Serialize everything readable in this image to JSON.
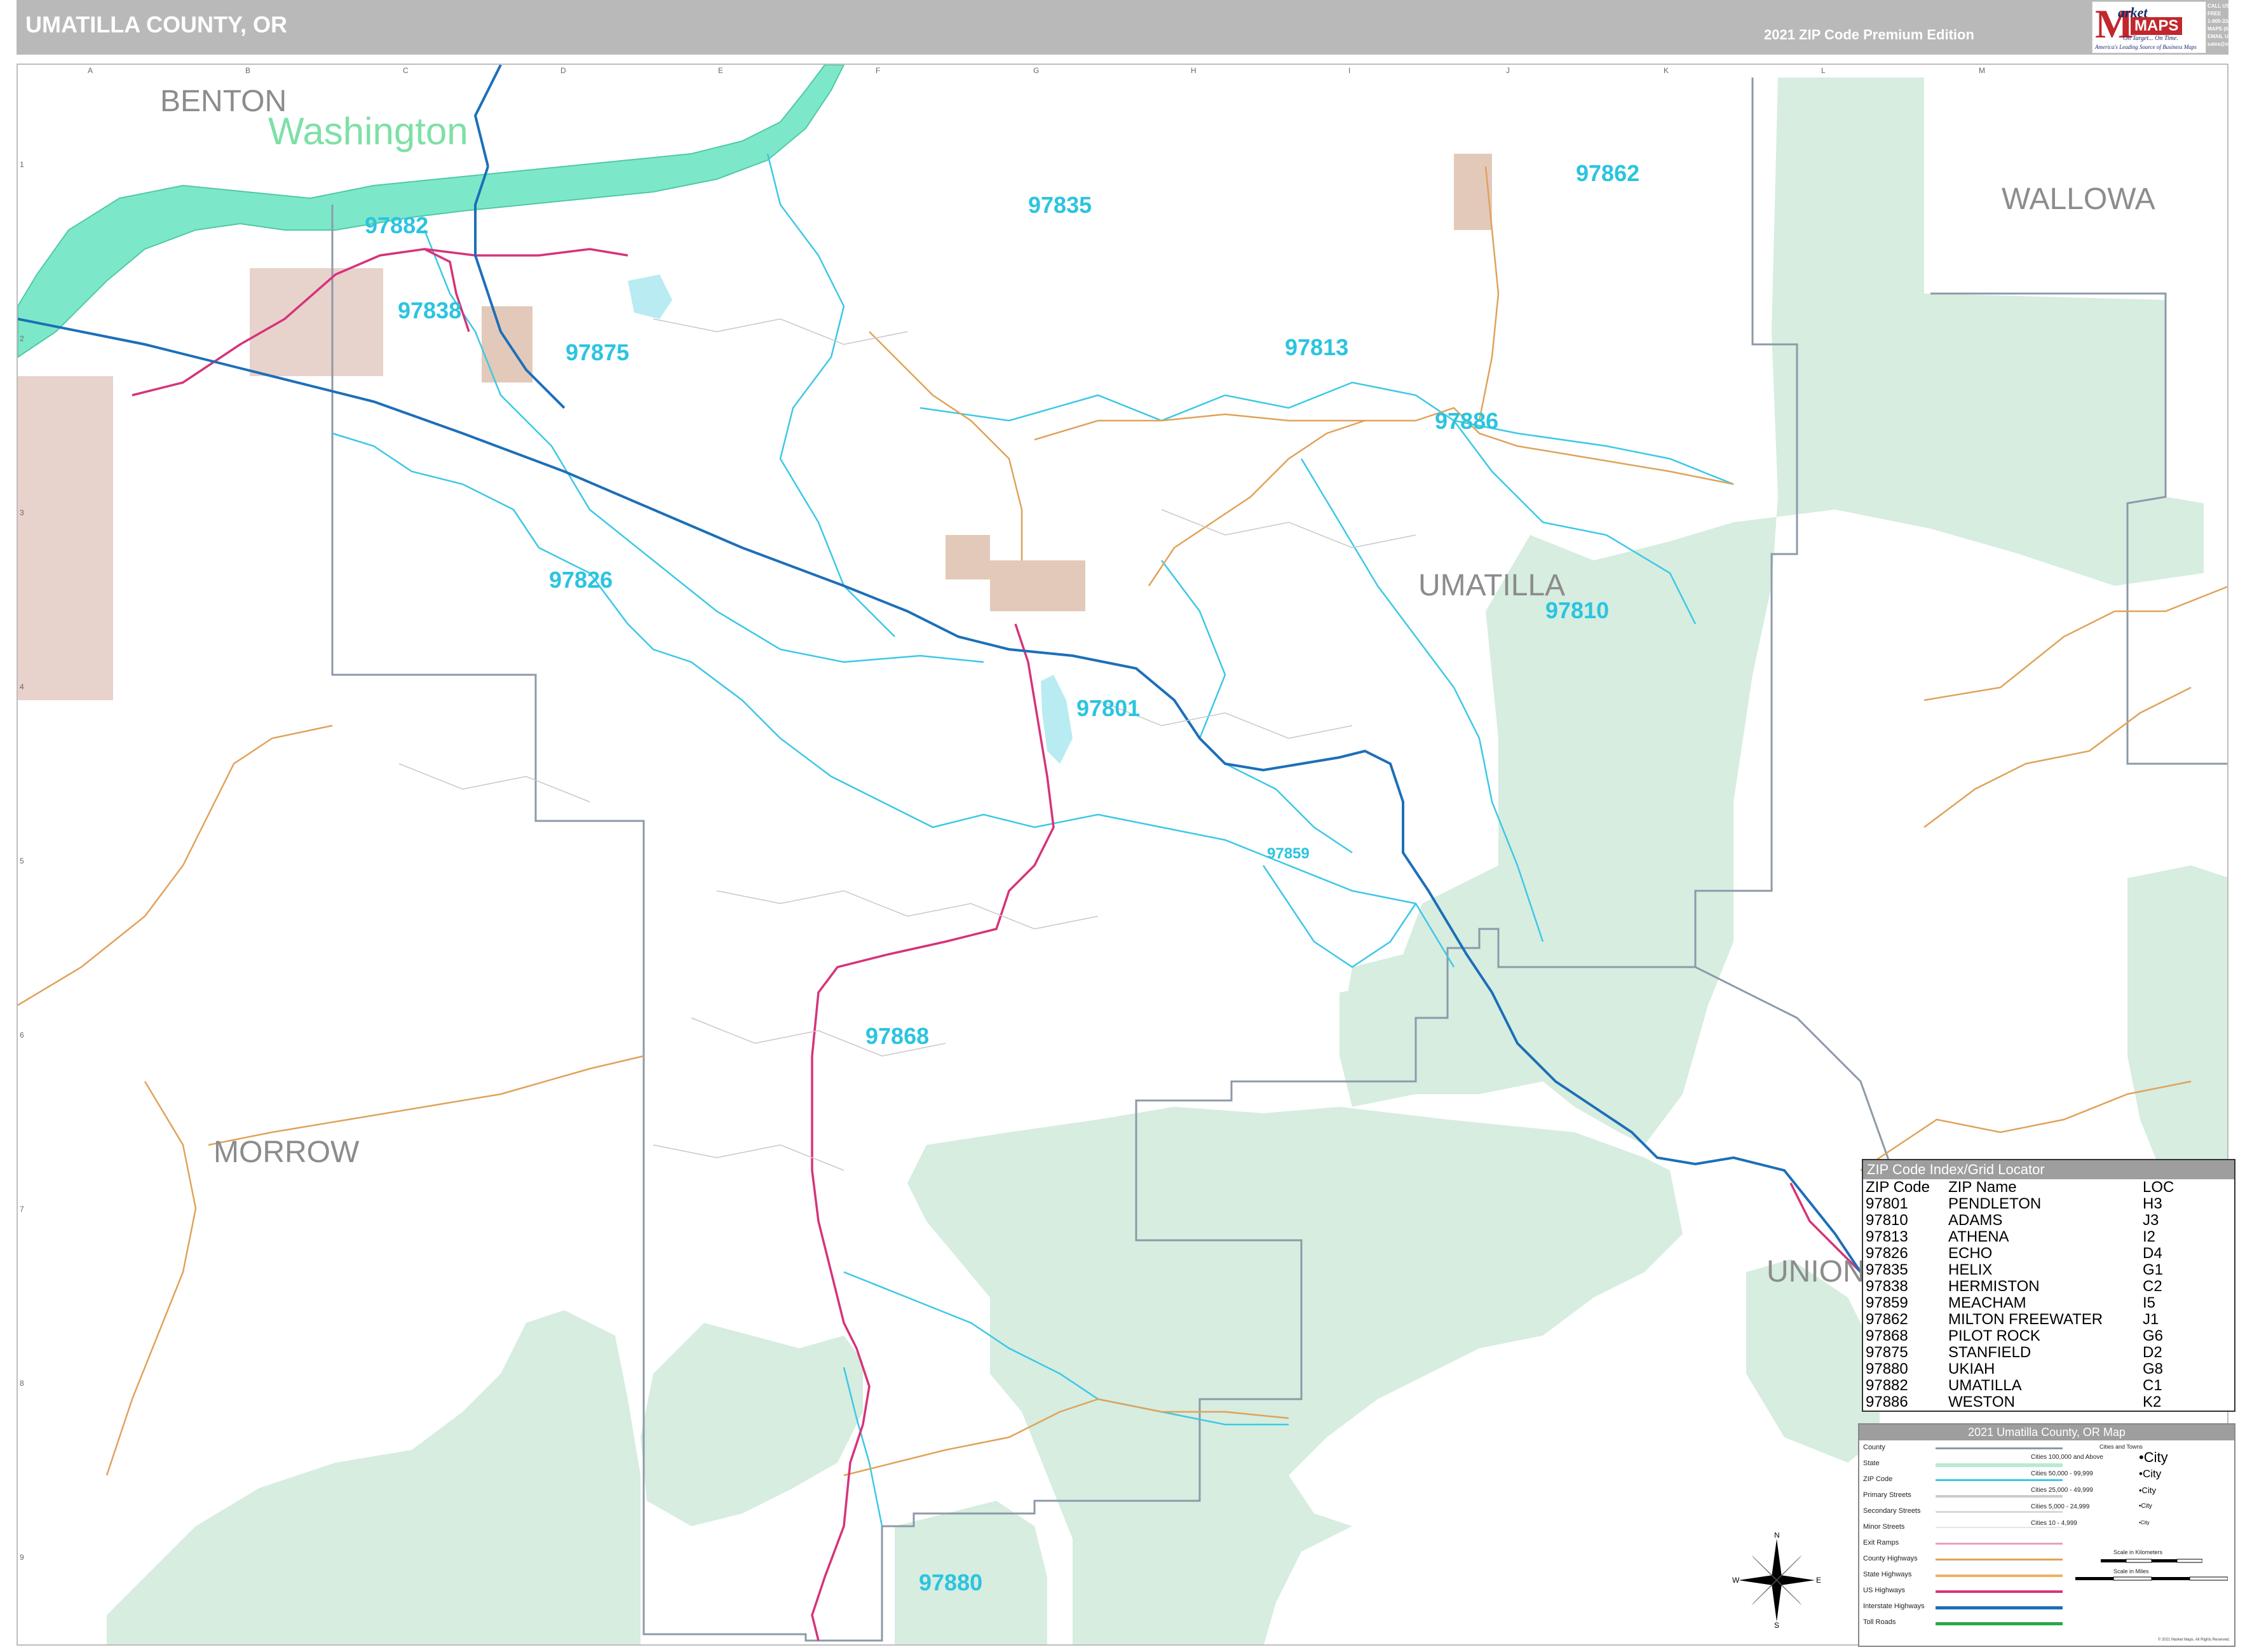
{
  "header": {
    "title": "UMATILLA COUNTY, OR",
    "edition": "2021 ZIP Code Premium Edition"
  },
  "logo": {
    "mark": "M",
    "brand_top": "arket",
    "brand_bottom": "MAPS",
    "tagline": "On Target... On Time.",
    "subtagline": "America's Leading Source of Business Maps"
  },
  "contact": {
    "line1": "CALL US TOLL FREE",
    "line2": "1-800-334-MAPS (6277)",
    "line3": "EMAIL US AT",
    "line4": "sales@marketmaps.com"
  },
  "grid": {
    "columns": [
      "A",
      "B",
      "C",
      "D",
      "E",
      "F",
      "G",
      "H",
      "I",
      "J",
      "K",
      "L",
      "M"
    ],
    "rows": [
      "1",
      "2",
      "3",
      "4",
      "5",
      "6",
      "7",
      "8",
      "9"
    ]
  },
  "map": {
    "colors": {
      "forest": "#d6ede0",
      "river": "#7de8c9",
      "interstate": "#1c6fb8",
      "us_highway": "#d6337a",
      "county_highway": "#e0a25a",
      "zip_boundary": "#3cc8e6",
      "county_line": "#8c9aa8",
      "urban": "#e3c9b9",
      "military": "#e8d2cc"
    },
    "county_labels": [
      {
        "id": "benton",
        "text": "BENTON"
      },
      {
        "id": "wallowa",
        "text": "WALLOWA"
      },
      {
        "id": "umatilla",
        "text": "UMATILLA"
      },
      {
        "id": "morrow",
        "text": "MORROW"
      },
      {
        "id": "union",
        "text": "UNION"
      }
    ],
    "state_label": "Washington",
    "zip_labels": [
      {
        "id": "97882",
        "text": "97882"
      },
      {
        "id": "97838",
        "text": "97838"
      },
      {
        "id": "97875",
        "text": "97875"
      },
      {
        "id": "97835",
        "text": "97835"
      },
      {
        "id": "97862",
        "text": "97862"
      },
      {
        "id": "97813",
        "text": "97813"
      },
      {
        "id": "97886",
        "text": "97886"
      },
      {
        "id": "97826",
        "text": "97826"
      },
      {
        "id": "97810",
        "text": "97810"
      },
      {
        "id": "97801",
        "text": "97801"
      },
      {
        "id": "97859",
        "text": "97859"
      },
      {
        "id": "97868",
        "text": "97868"
      },
      {
        "id": "97880",
        "text": "97880"
      }
    ]
  },
  "zip_index": {
    "title": "ZIP Code Index/Grid Locator",
    "headers": [
      "ZIP Code",
      "ZIP Name",
      "LOC"
    ],
    "rows": [
      [
        "97801",
        "PENDLETON",
        "H3"
      ],
      [
        "97810",
        "ADAMS",
        "J3"
      ],
      [
        "97813",
        "ATHENA",
        "I2"
      ],
      [
        "97826",
        "ECHO",
        "D4"
      ],
      [
        "97835",
        "HELIX",
        "G1"
      ],
      [
        "97838",
        "HERMISTON",
        "C2"
      ],
      [
        "97859",
        "MEACHAM",
        "I5"
      ],
      [
        "97862",
        "MILTON FREEWATER",
        "J1"
      ],
      [
        "97868",
        "PILOT ROCK",
        "G6"
      ],
      [
        "97875",
        "STANFIELD",
        "D2"
      ],
      [
        "97880",
        "UKIAH",
        "G8"
      ],
      [
        "97882",
        "UMATILLA",
        "C1"
      ],
      [
        "97886",
        "WESTON",
        "K2"
      ]
    ]
  },
  "legend": {
    "title": "2021 Umatilla County, OR Map",
    "items": [
      "County",
      "State",
      "ZIP Code",
      "Primary Streets",
      "Secondary Streets",
      "Minor Streets",
      "Exit Ramps",
      "County Highways",
      "State Highways",
      "US Highways",
      "Interstate Highways",
      "Toll Roads"
    ],
    "cities_heading": "Cities and Towns",
    "cities": [
      {
        "range": "Cities 100,000 and Above",
        "sample": "•City"
      },
      {
        "range": "Cities 50,000 - 99,999",
        "sample": "•City"
      },
      {
        "range": "Cities 25,000 - 49,999",
        "sample": "•City"
      },
      {
        "range": "Cities 5,000 - 24,999",
        "sample": "•City"
      },
      {
        "range": "Cities 10 - 4,999",
        "sample": "•City"
      }
    ],
    "scale_km": "Scale in Kilometers",
    "scale_mi": "Scale in Miles",
    "copyright": "© 2021 Market Maps. All Rights Reserved."
  },
  "compass": {
    "n": "N",
    "s": "S",
    "e": "E",
    "w": "W"
  }
}
